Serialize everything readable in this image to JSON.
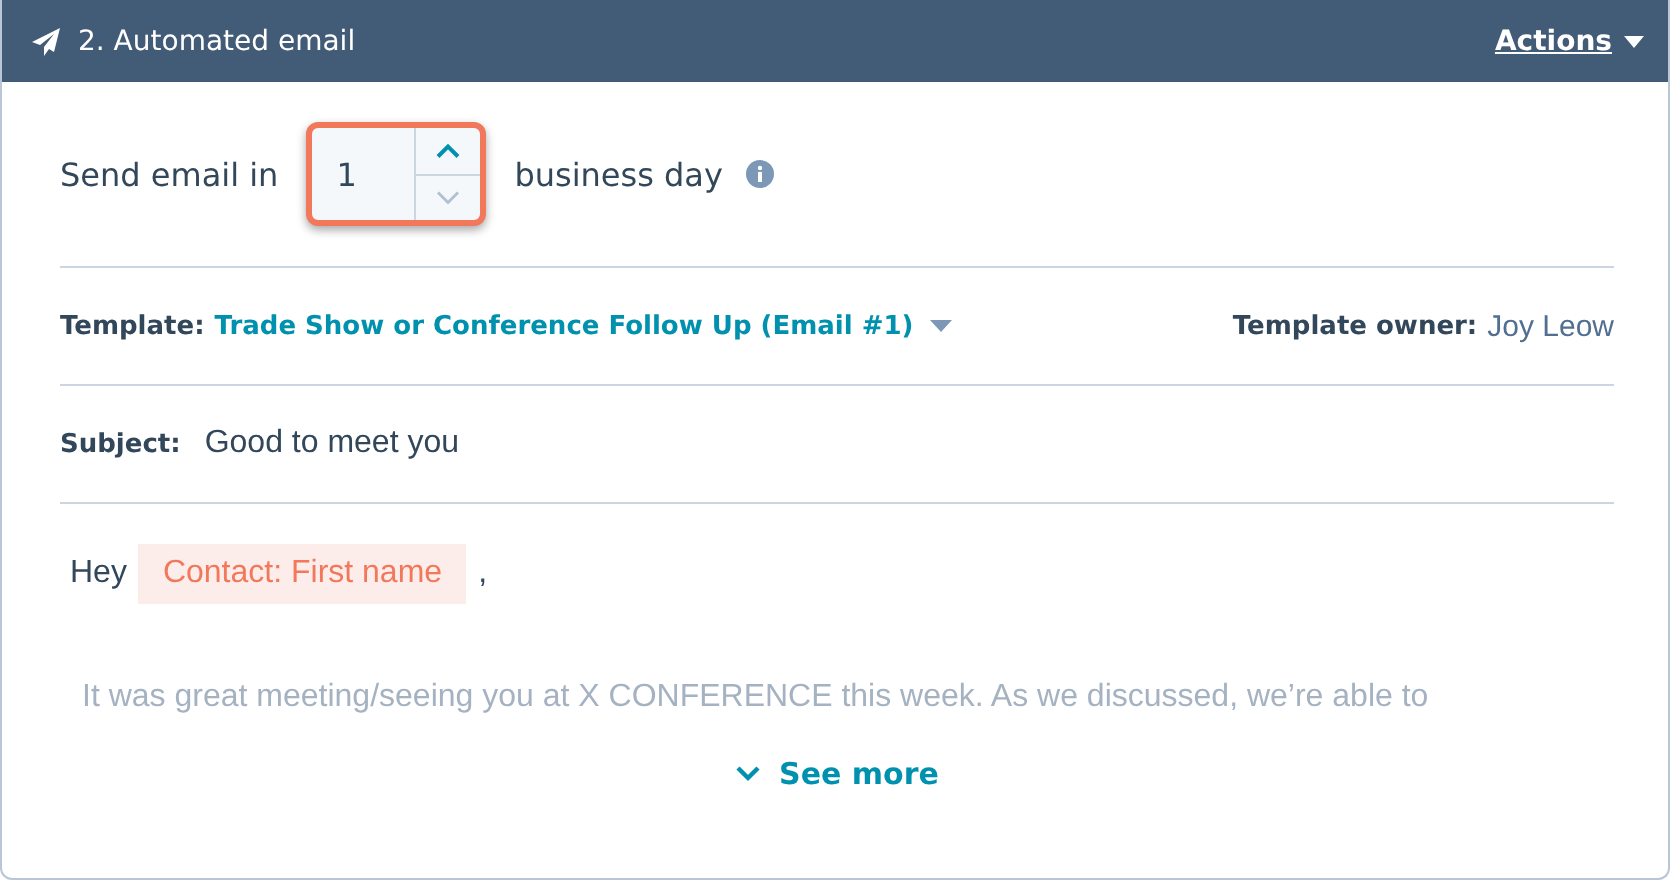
{
  "header": {
    "title": "2. Automated email",
    "actions": "Actions"
  },
  "delay": {
    "label": "Send email in",
    "value": "1",
    "unit": "business day",
    "highlighted": true
  },
  "template": {
    "label": "Template:",
    "name": "Trade Show or Conference Follow Up (Email #1)",
    "owner_label": "Template owner:",
    "owner": "Joy Leow"
  },
  "subject": {
    "label": "Subject:",
    "value": "Good to meet you"
  },
  "body": {
    "greeting": "Hey",
    "token": "Contact: First name",
    "after_token": ",",
    "preview": "It was great meeting/seeing you at X CONFERENCE this week. As we discussed, we’re able to"
  },
  "see_more": "See more"
}
